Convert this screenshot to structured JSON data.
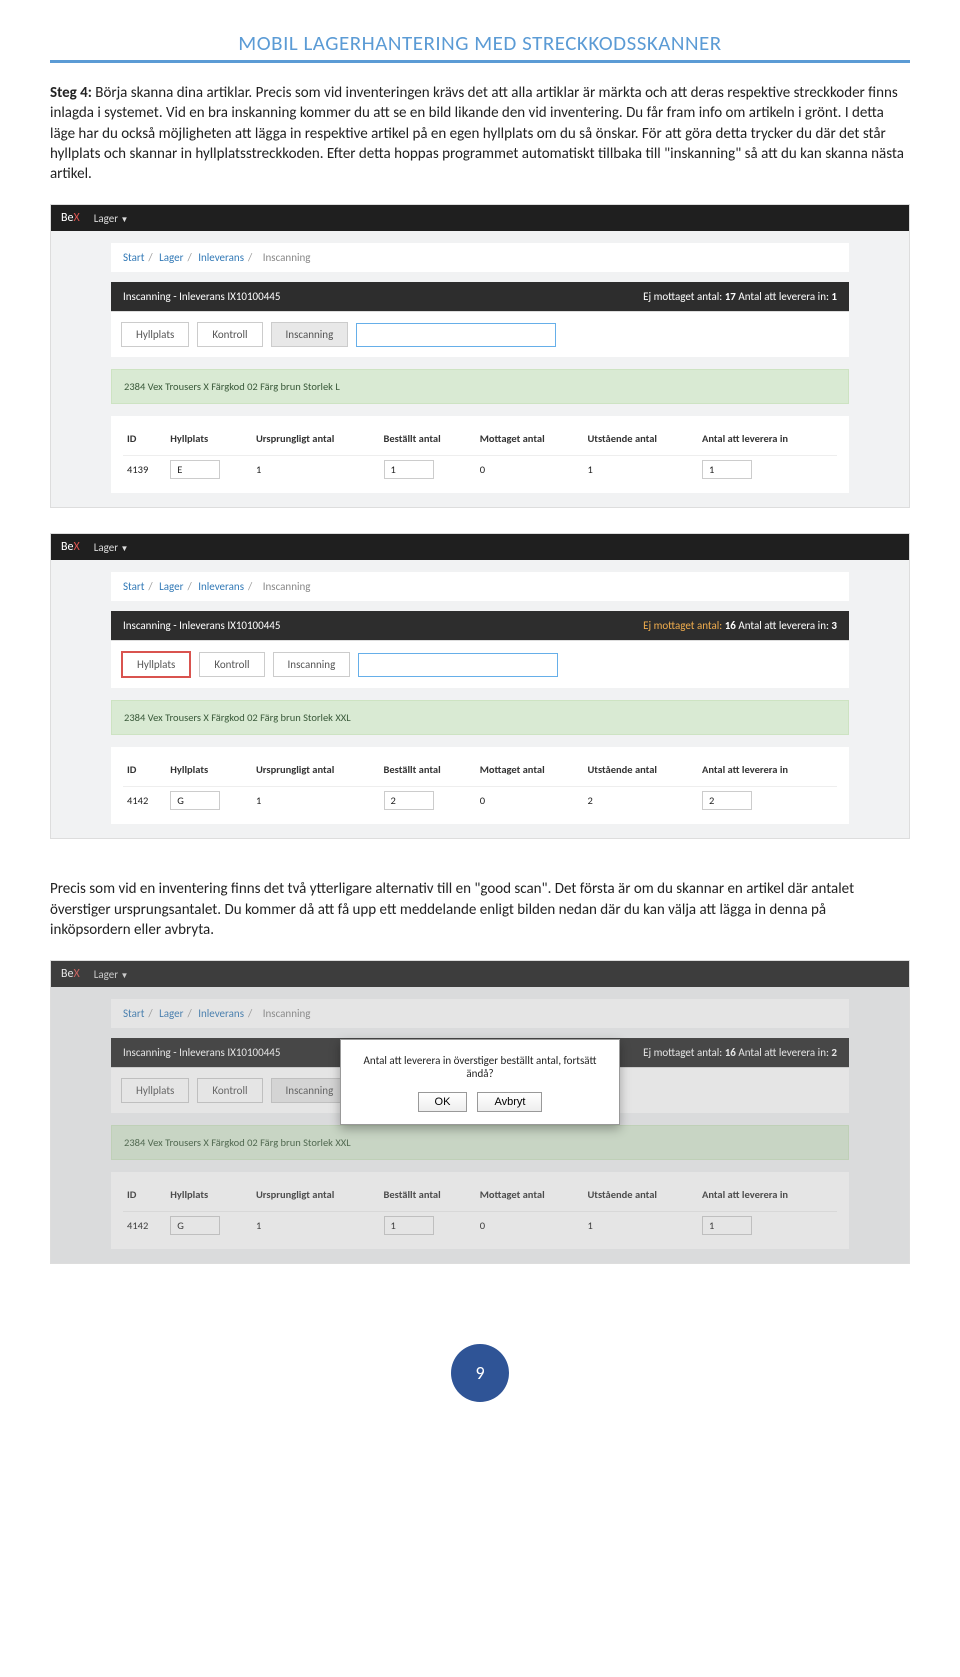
{
  "doc": {
    "title": "MOBIL LAGERHANTERING MED STRECKKODSSKANNER",
    "step_label": "Steg 4:",
    "para1": " Börja skanna dina artiklar. Precis som vid inventeringen krävs det att alla artiklar är märkta och att deras respektive streckkoder finns inlagda i systemet. Vid en bra inskanning kommer du att se en bild likande den vid inventering. Du får fram info om artikeln i grönt. I detta läge har du också möjligheten att lägga in respektive artikel på en egen hyllplats om du så önskar. För att göra detta trycker du där det står hyllplats och skannar in hyllplatsstreckkoden. Efter detta hoppas programmet automatiskt tillbaka till \"inskanning\" så att du kan skanna nästa artikel.",
    "para2": "Precis som vid en inventering finns det två ytterligare alternativ till en \"good scan\". Det första är om du skannar en artikel där antalet överstiger ursprungsantalet. Du kommer då att få upp ett meddelande enligt bilden nedan där du kan välja att lägga in denna på inköpsordern eller avbryta.",
    "page_num": "9"
  },
  "common": {
    "brand_be": "Be",
    "brand_x": "X",
    "menu_lager": "Lager",
    "bc_start": "Start",
    "bc_lager": "Lager",
    "bc_inlev": "Inleverans",
    "bc_inscan": "Inscanning",
    "tab_hyllplats": "Hyllplats",
    "tab_kontroll": "Kontroll",
    "tab_inscan": "Inscanning",
    "th_id": "ID",
    "th_hyllplats": "Hyllplats",
    "th_urspr": "Ursprungligt antal",
    "th_bestallt": "Beställt antal",
    "th_mottaget": "Mottaget antal",
    "th_utstaende": "Utstående antal",
    "th_antal_lev": "Antal att leverera in"
  },
  "shot1": {
    "panel_title": "Inscanning - Inleverans IX10100445",
    "panel_right_prefix": "Ej mottaget antal:",
    "panel_right_a": "17",
    "panel_right_mid": "Antal att leverera in:",
    "panel_right_b": "1",
    "green": "2384 Vex Trousers X Färgkod 02 Färg brun Storlek L",
    "row": {
      "id": "4139",
      "hyll": "E",
      "urspr": "1",
      "best": "1",
      "mott": "0",
      "uts": "1",
      "lev": "1"
    }
  },
  "shot2": {
    "panel_title": "Inscanning - Inleverans IX10100445",
    "panel_right_prefix": "Ej mottaget antal:",
    "panel_right_a": "16",
    "panel_right_mid": "Antal att leverera in:",
    "panel_right_b": "3",
    "green": "2384 Vex Trousers X Färgkod 02 Färg brun Storlek XXL",
    "row": {
      "id": "4142",
      "hyll": "G",
      "urspr": "1",
      "best": "2",
      "mott": "0",
      "uts": "2",
      "lev": "2"
    }
  },
  "shot3": {
    "panel_title": "Inscanning - Inleverans IX10100445",
    "panel_right_prefix": "Ej mottaget antal:",
    "panel_right_a": "16",
    "panel_right_mid": "Antal att leverera in:",
    "panel_right_b": "2",
    "green": "2384 Vex Trousers X Färgkod 02 Färg brun Storlek XXL",
    "row": {
      "id": "4142",
      "hyll": "G",
      "urspr": "1",
      "best": "1",
      "mott": "0",
      "uts": "1",
      "lev": "1"
    },
    "modal_msg": "Antal att leverera in överstiger beställt antal, fortsätt ändå?",
    "modal_ok": "OK",
    "modal_cancel": "Avbryt"
  }
}
